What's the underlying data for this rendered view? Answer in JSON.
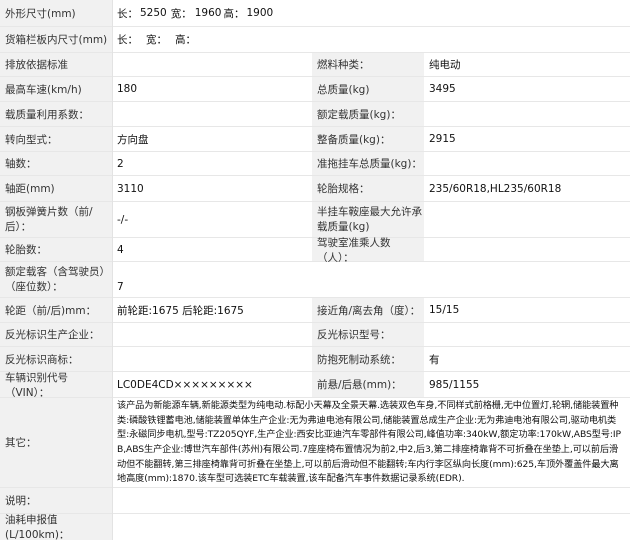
{
  "row_outer": {
    "label": "外形尺寸(mm)",
    "len_label": "长：",
    "len": "5250",
    "wid_label": "宽：",
    "wid": "1960",
    "hgt_label": "高：",
    "hgt": "1900"
  },
  "row_box": {
    "label": "货箱栏板内尺寸(mm)",
    "len_label": "长：",
    "wid_label": "宽：",
    "hgt_label": "高："
  },
  "row_emission": {
    "label": "排放依据标准",
    "label2": "燃料种类：",
    "value2": "纯电动"
  },
  "row_speed": {
    "label": "最高车速(km/h)",
    "value": "180",
    "label2": "总质量(kg)",
    "value2": "3495"
  },
  "row_util": {
    "label": "载质量利用系数：",
    "label2": "额定载质量(kg)："
  },
  "row_steer": {
    "label": "转向型式：",
    "value": "方向盘",
    "label2": "整备质量(kg)：",
    "value2": "2915"
  },
  "row_axles": {
    "label": "轴数：",
    "value": "2",
    "label2": "准拖挂车总质量(kg)："
  },
  "row_wheelbase": {
    "label": "轴距(mm)",
    "value": "3110",
    "label2": "轮胎规格：",
    "value2": "235/60R18,HL235/60R18"
  },
  "row_spring": {
    "label": "钢板弹簧片数（前/后）：",
    "value": "-/-",
    "label2": "半挂车鞍座最大允许承载质量(kg)"
  },
  "row_tires": {
    "label": "轮胎数：",
    "value": "4",
    "label2": "驾驶室准乘人数（人）："
  },
  "row_seats": {
    "label": "额定载客（含驾驶员）（座位数）：",
    "value": "7"
  },
  "row_track": {
    "label": "轮距（前/后)mm：",
    "value": "前轮距:1675 后轮距:1675",
    "label2": "接近角/离去角（度）：",
    "value2": "15/15"
  },
  "row_refl_mfr": {
    "label": "反光标识生产企业：",
    "label2": "反光标识型号："
  },
  "row_refl_brand": {
    "label": "反光标识商标：",
    "label2": "防抱死制动系统：",
    "value2": "有"
  },
  "row_vin": {
    "label": "车辆识别代号（VIN）：",
    "value": "LC0DE4CD×××××××××",
    "label2": "前悬/后悬(mm)：",
    "value2": "985/1155"
  },
  "row_other": {
    "label": "其它：",
    "value": "该产品为新能源车辆,新能源类型为纯电动.标配小天幕及全景天幕.选装双色车身,不同样式前格栅,无中位置灯,轮辋,储能装置种类:磷酸铁锂蓄电池,储能装置单体生产企业:无为弗迪电池有限公司,储能装置总成生产企业:无为弗迪电池有限公司,驱动电机类型:永磁同步电机,型号:TZ205QYF,生产企业:西安比亚迪汽车零部件有限公司,峰值功率:340kW,额定功率:170kW,ABS型号:IPB,ABS生产企业:博世汽车部件(苏州)有限公司.7座座椅布置情况为前2,中2,后3,第二排座椅靠背不可折叠在坐垫上,可以前后滑动但不能翻转,第三排座椅靠背可折叠在坐垫上,可以前后滑动但不能翻转;车内行李区纵向长度(mm):625,车顶外覆盖件最大离地高度(mm):1870.该车型可选装ETC车载装置,该车配备汽车事件数据记录系统(EDR)."
  },
  "row_notes": {
    "label": "说明："
  },
  "row_fuel": {
    "label": "油耗申报值(L/100km)："
  }
}
